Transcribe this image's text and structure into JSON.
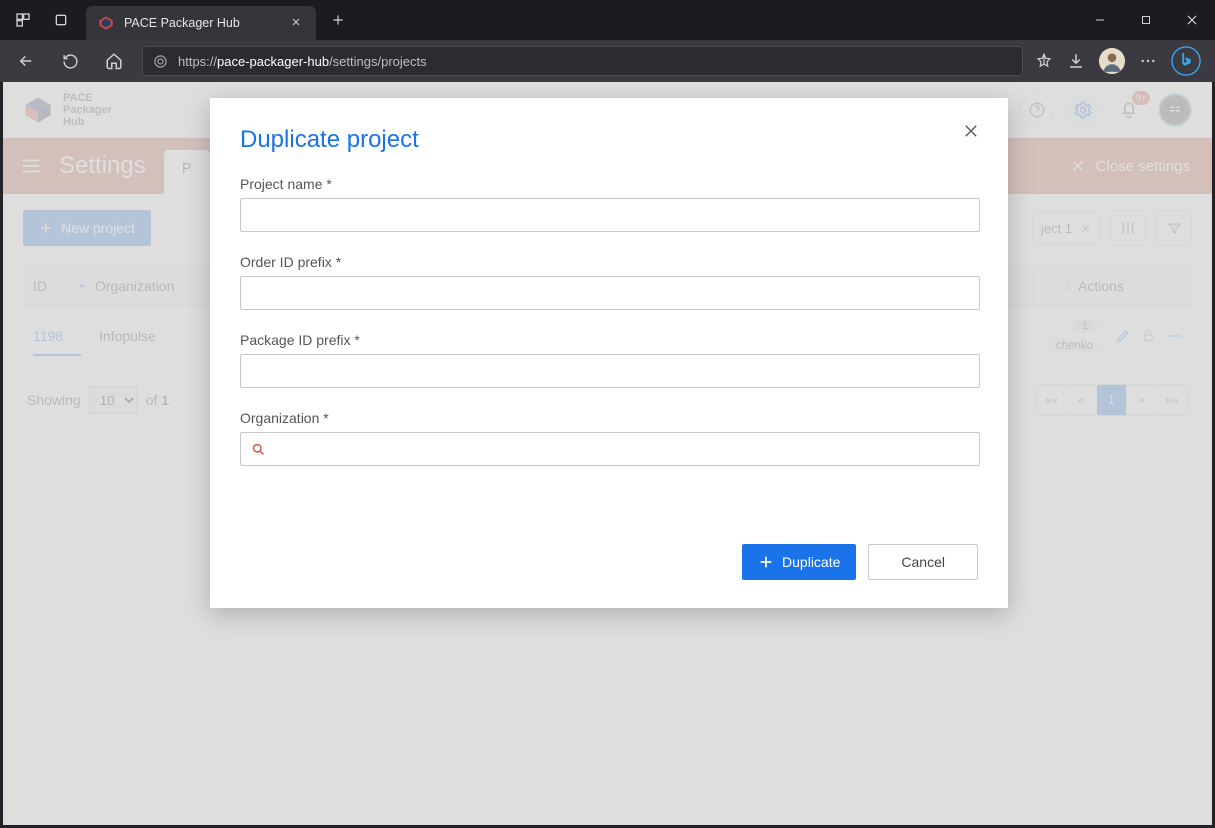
{
  "browser": {
    "tab_title": "PACE Packager Hub",
    "url_prefix": "https://",
    "url_host": "pace-packager-hub",
    "url_path": "/settings/projects"
  },
  "header": {
    "brand_line1": "PACE",
    "brand_line2": "Packager",
    "brand_line3": "Hub",
    "notif_badge": "9+"
  },
  "settings_bar": {
    "title": "Settings",
    "tab_visible": "P",
    "close_label": "Close settings"
  },
  "toolbar": {
    "new_project": "New project",
    "filter_chip": "ject 1"
  },
  "table": {
    "col_id": "ID",
    "col_org": "Organization",
    "col_actions": "Actions",
    "rows": [
      {
        "id": "1198",
        "org": "Infopulse",
        "pill_count": "1",
        "pill_text": "chenko"
      }
    ]
  },
  "footer": {
    "showing": "Showing",
    "page_size": "10",
    "of": "of",
    "total": "1",
    "pager_first": "««",
    "pager_prev": "«",
    "pager_current": "1",
    "pager_next": "»",
    "pager_last": "»»"
  },
  "modal": {
    "title": "Duplicate project",
    "lbl_name": "Project name *",
    "lbl_order": "Order ID prefix *",
    "lbl_package": "Package ID prefix *",
    "lbl_org": "Organization *",
    "btn_dup": "Duplicate",
    "btn_cancel": "Cancel"
  }
}
